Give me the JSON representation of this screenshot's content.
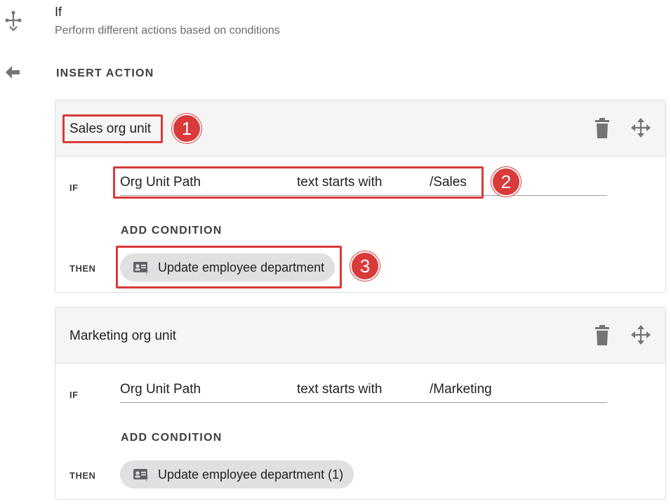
{
  "header": {
    "title": "If",
    "subtitle": "Perform different actions based on conditions",
    "icon": "flow-split-icon"
  },
  "insert_action_label": "INSERT ACTION",
  "cards": [
    {
      "name": "Sales org unit",
      "if_label": "IF",
      "condition": {
        "field": "Org Unit Path",
        "operator": "text starts with",
        "value": "/Sales"
      },
      "add_condition_label": "ADD CONDITION",
      "then_label": "THEN",
      "action_chip": "Update employee department"
    },
    {
      "name": "Marketing org unit",
      "if_label": "IF",
      "condition": {
        "field": "Org Unit Path",
        "operator": "text starts with",
        "value": "/Marketing"
      },
      "add_condition_label": "ADD CONDITION",
      "then_label": "THEN",
      "action_chip": "Update employee department (1)"
    }
  ],
  "annotations": [
    "1",
    "2",
    "3"
  ],
  "colors": {
    "annotation_red": "#d93a3a",
    "chip_bg": "#e0e0e0",
    "card_header_bg": "#f5f5f5",
    "icon_gray": "#757575"
  }
}
